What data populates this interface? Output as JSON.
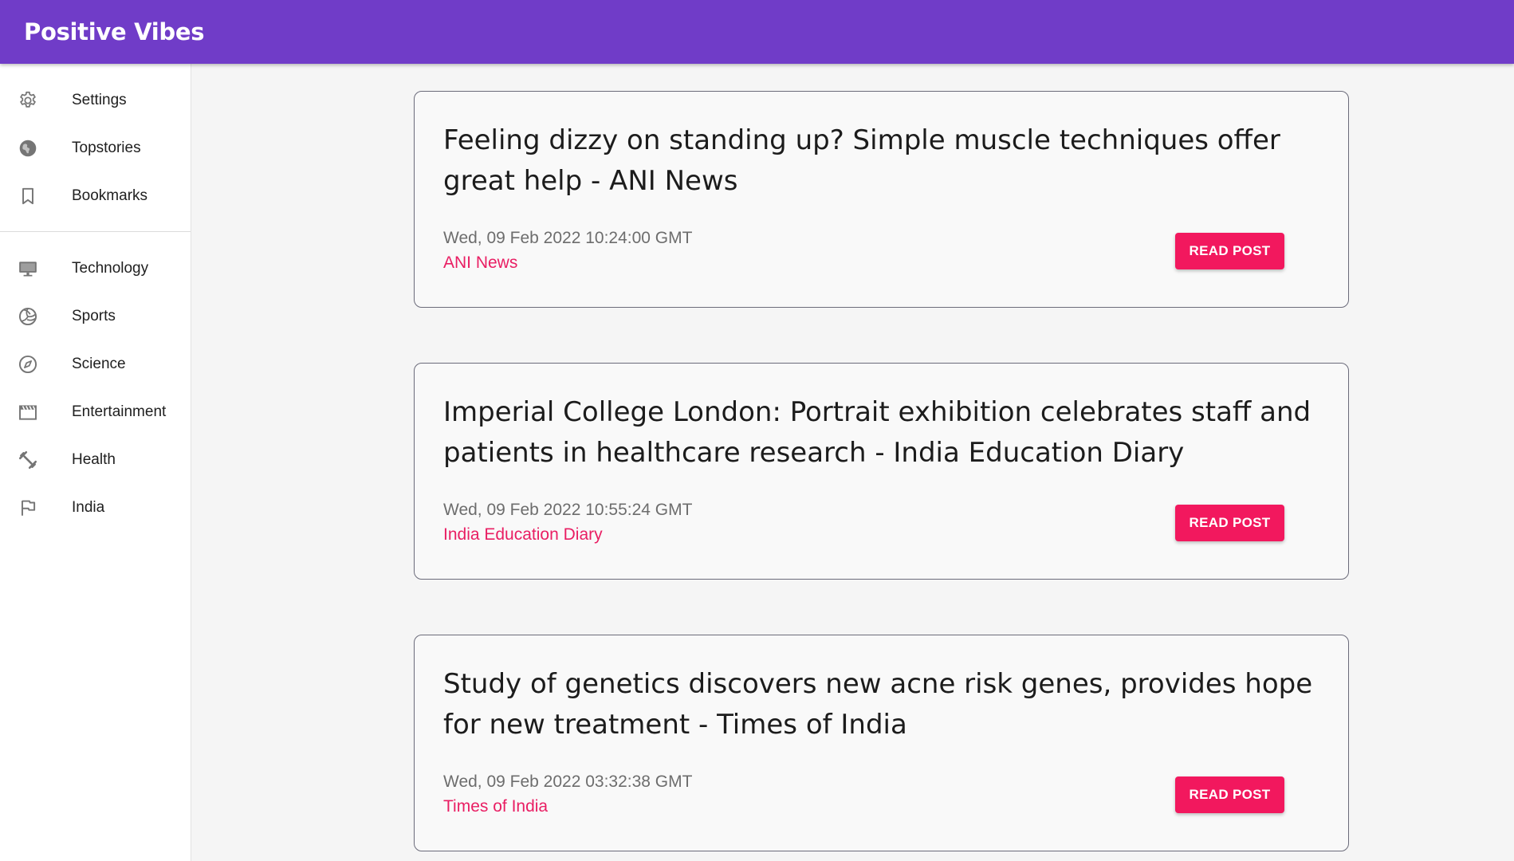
{
  "app": {
    "title": "Positive Vibes",
    "accent": "#703cc8",
    "highlight": "#e91e63"
  },
  "sidebar": {
    "primary": [
      {
        "label": "Settings",
        "icon": "gear-icon"
      },
      {
        "label": "Topstories",
        "icon": "globe-icon"
      },
      {
        "label": "Bookmarks",
        "icon": "bookmark-icon"
      }
    ],
    "categories": [
      {
        "label": "Technology",
        "icon": "monitor-icon"
      },
      {
        "label": "Sports",
        "icon": "volleyball-icon"
      },
      {
        "label": "Science",
        "icon": "compass-icon"
      },
      {
        "label": "Entertainment",
        "icon": "film-icon"
      },
      {
        "label": "Health",
        "icon": "dumbbell-icon"
      },
      {
        "label": "India",
        "icon": "flag-icon"
      }
    ]
  },
  "feed": {
    "read_label": "READ POST",
    "posts": [
      {
        "title": "Feeling dizzy on standing up? Simple muscle techniques offer great help - ANI News",
        "date": "Wed, 09 Feb 2022 10:24:00 GMT",
        "source": "ANI News"
      },
      {
        "title": "Imperial College London: Portrait exhibition celebrates staff and patients in healthcare research - India Education Diary",
        "date": "Wed, 09 Feb 2022 10:55:24 GMT",
        "source": "India Education Diary"
      },
      {
        "title": "Study of genetics discovers new acne risk genes, provides hope for new treatment - Times of India",
        "date": "Wed, 09 Feb 2022 03:32:38 GMT",
        "source": "Times of India"
      }
    ]
  }
}
